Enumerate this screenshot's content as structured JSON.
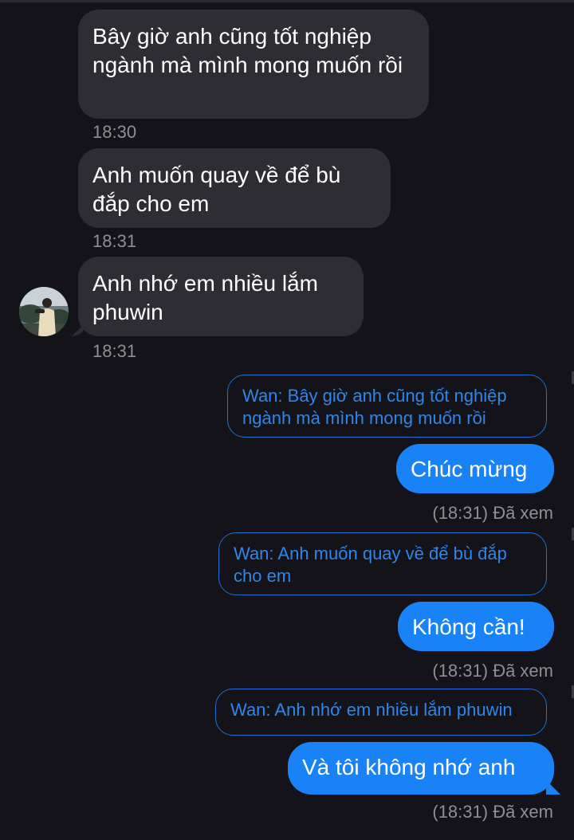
{
  "messages_in": [
    {
      "text": "Bây giờ anh cũng tốt nghiệp ngành mà mình mong muốn rồi",
      "time": "18:30"
    },
    {
      "text": "Anh muốn quay về để bù đắp cho em",
      "time": "18:31"
    },
    {
      "text": "Anh nhớ em nhiều lắm phuwin",
      "time": "18:31"
    }
  ],
  "messages_out": [
    {
      "quote": "Wan: Bây giờ anh cũng tốt nghiệp ngành mà mình mong muốn rồi",
      "text": "Chúc mừng",
      "status": "(18:31) Đã xem"
    },
    {
      "quote": "Wan: Anh muốn quay về để bù đắp cho em",
      "text": "Không cần!",
      "status": "(18:31) Đã xem"
    },
    {
      "quote": "Wan: Anh nhớ em nhiều lắm phuwin",
      "text": "Và tôi không nhớ anh",
      "status": "(18:31) Đã xem"
    }
  ],
  "colors": {
    "background": "#14131a",
    "incoming_bubble": "#2e2d33",
    "outgoing_bubble": "#1a82f7",
    "quote_border": "#1e6fd0",
    "quote_text": "#2f86ea",
    "timestamp": "#8e8e93"
  },
  "avatar": {
    "icon": "profile-photo"
  }
}
